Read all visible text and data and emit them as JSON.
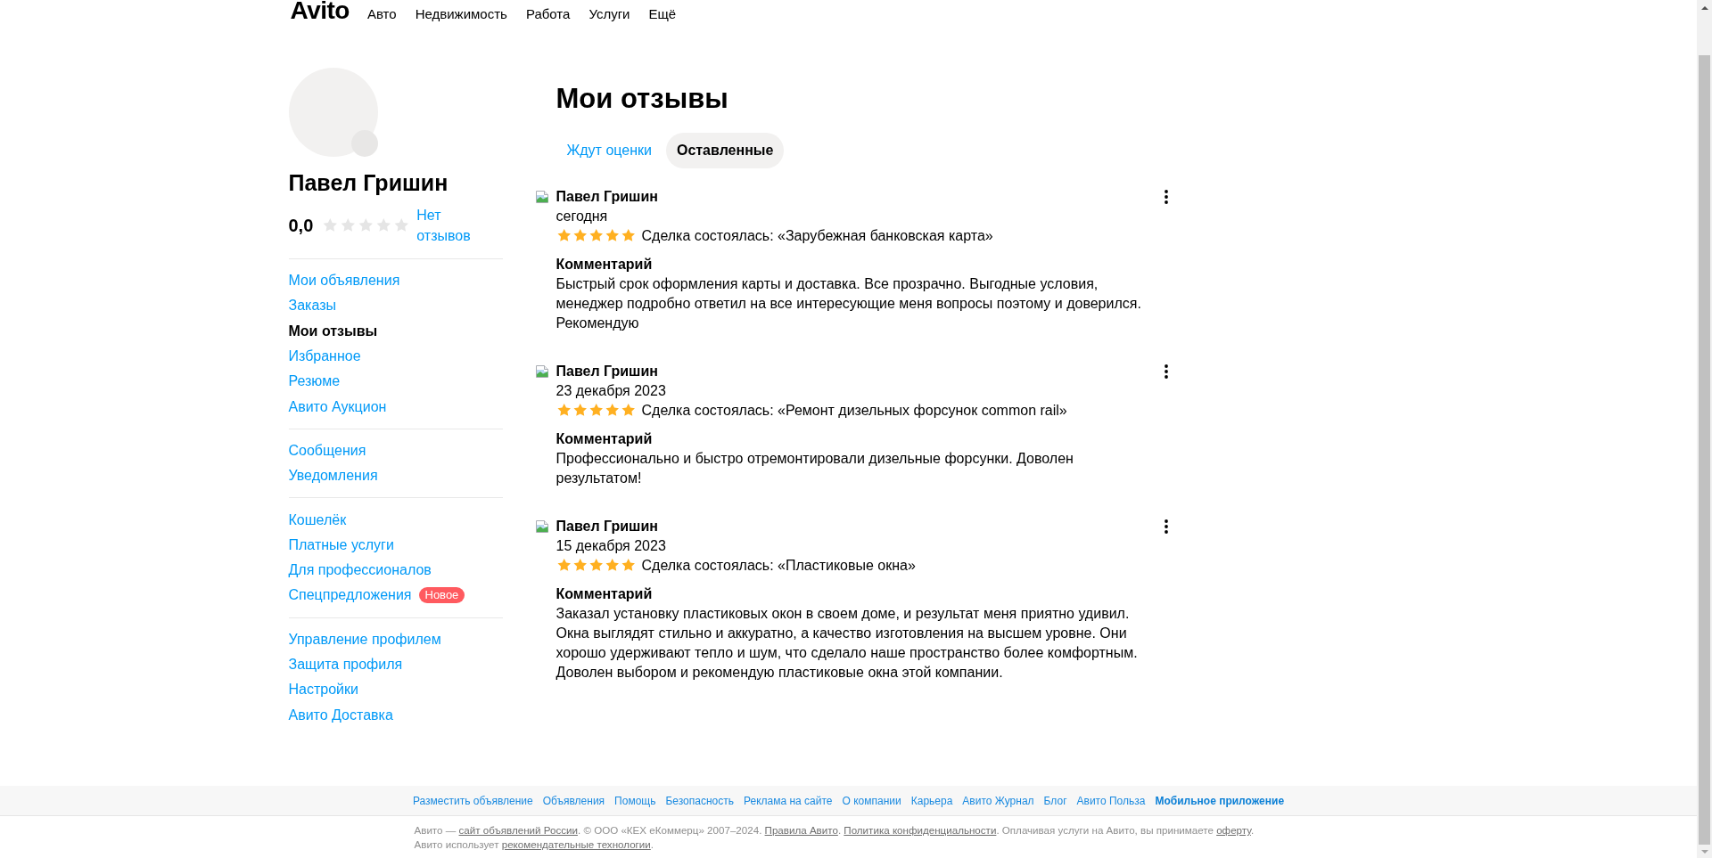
{
  "header": {
    "logo": "Avito",
    "nav": [
      "Авто",
      "Недвижимость",
      "Работа",
      "Услуги",
      "Ещё"
    ]
  },
  "profile": {
    "name": "Павел Гришин",
    "rating": "0,0",
    "stars": 0,
    "reviews_link": "Нет отзывов"
  },
  "sidebar": {
    "groups": [
      {
        "items": [
          {
            "label": "Мои объявления",
            "selected": false
          },
          {
            "label": "Заказы",
            "selected": false
          },
          {
            "label": "Мои отзывы",
            "selected": true
          },
          {
            "label": "Избранное",
            "selected": false
          },
          {
            "label": "Резюме",
            "selected": false
          },
          {
            "label": "Авито Аукцион",
            "selected": false
          }
        ]
      },
      {
        "items": [
          {
            "label": "Сообщения",
            "selected": false
          },
          {
            "label": "Уведомления",
            "selected": false
          }
        ]
      },
      {
        "items": [
          {
            "label": "Кошелёк",
            "selected": false
          },
          {
            "label": "Платные услуги",
            "selected": false
          },
          {
            "label": "Для профессионалов",
            "selected": false
          },
          {
            "label": "Спецпредложения",
            "selected": false,
            "badge": "Новое"
          }
        ]
      },
      {
        "items": [
          {
            "label": "Управление профилем",
            "selected": false
          },
          {
            "label": "Защита профиля",
            "selected": false
          },
          {
            "label": "Настройки",
            "selected": false
          },
          {
            "label": "Авито Доставка",
            "selected": false
          }
        ]
      }
    ]
  },
  "page_title": "Мои отзывы",
  "tabs": [
    {
      "label": "Ждут оценки",
      "selected": false
    },
    {
      "label": "Оставленные",
      "selected": true
    }
  ],
  "reviews": [
    {
      "author": "Павел Гришин",
      "date": "сегодня",
      "stars": 5,
      "deal": "Сделка состоялась: «Зарубежная банковская карта»",
      "comment_label": "Комментарий",
      "comment": "Быстрый срок оформления карты и доставка. Все прозрачно. Выгодные условия, менеджер подробно ответил на все интересующие меня вопросы поэтому и доверился. Рекомендую"
    },
    {
      "author": "Павел Гришин",
      "date": "23 декабря 2023",
      "stars": 5,
      "deal": "Сделка состоялась: «Ремонт дизельных форсунок common rail»",
      "comment_label": "Комментарий",
      "comment": "Профессионально и быстро отремонтировали дизельные форсунки. Доволен результатом!"
    },
    {
      "author": "Павел Гришин",
      "date": "15 декабря 2023",
      "stars": 5,
      "deal": "Сделка состоялась: «Пластиковые окна»",
      "comment_label": "Комментарий",
      "comment": "Заказал установку пластиковых окон в своем доме, и результат меня приятно удивил. Окна выглядят стильно и аккуратно, а качество изготовления на высшем уровне. Они хорошо удерживают тепло и шум, что сделало наше пространство более комфортным. Доволен выбором и рекомендую пластиковые окна этой компании."
    }
  ],
  "footer": {
    "links": [
      {
        "label": "Разместить объявление",
        "highlighted": false
      },
      {
        "label": "Объявления",
        "highlighted": false
      },
      {
        "label": "Помощь",
        "highlighted": false
      },
      {
        "label": "Безопасность",
        "highlighted": false
      },
      {
        "label": "Реклама на сайте",
        "highlighted": false
      },
      {
        "label": "О компании",
        "highlighted": false
      },
      {
        "label": "Карьера",
        "highlighted": false
      },
      {
        "label": "Авито Журнал",
        "highlighted": false
      },
      {
        "label": "Блог",
        "highlighted": false
      },
      {
        "label": "Авито Польза",
        "highlighted": false
      },
      {
        "label": "Мобильное приложение",
        "highlighted": true
      }
    ],
    "copyright": [
      {
        "kind": "text",
        "text": "Авито — "
      },
      {
        "kind": "link",
        "text": "сайт объявлений России"
      },
      {
        "kind": "text",
        "text": ". © ООО «КЕХ еКоммерц» 2007–2024. "
      },
      {
        "kind": "link",
        "text": "Правила Авито"
      },
      {
        "kind": "text",
        "text": ". "
      },
      {
        "kind": "link",
        "text": "Политика конфиденциальности"
      },
      {
        "kind": "text",
        "text": ". Оплачивая услуги на Авито, вы принимаете "
      },
      {
        "kind": "link",
        "text": "оферту"
      },
      {
        "kind": "text",
        "text": ". Авито использует "
      },
      {
        "kind": "link",
        "text": "рекомендательные технологии"
      },
      {
        "kind": "text",
        "text": "."
      }
    ]
  }
}
